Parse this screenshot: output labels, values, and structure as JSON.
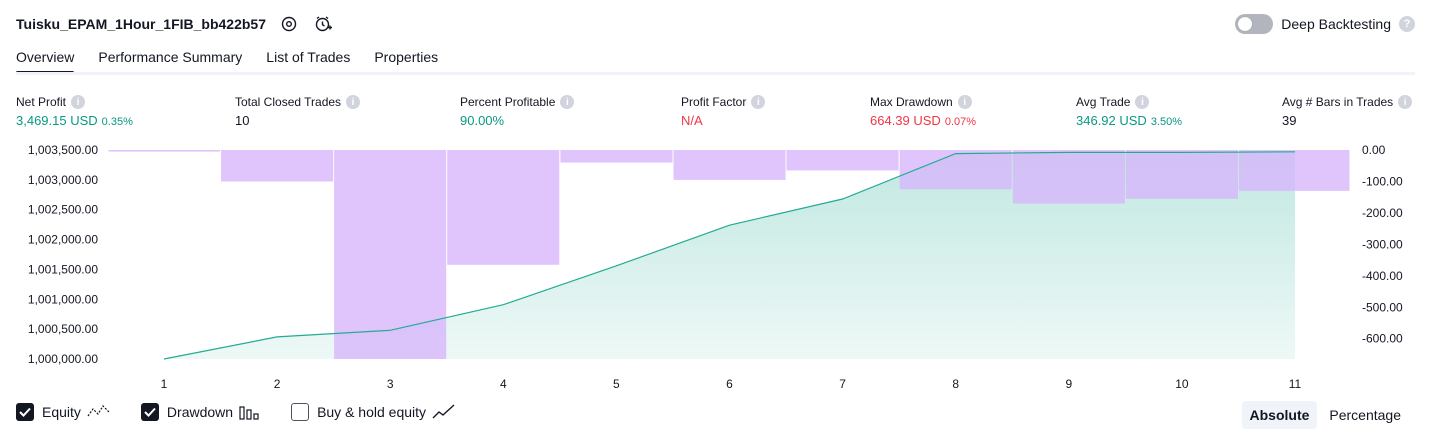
{
  "header": {
    "title": "Tuisku_EPAM_1Hour_1FIB_bb422b57",
    "icons": [
      "settings-icon",
      "add-alert-icon"
    ],
    "deep_backtesting_label": "Deep Backtesting",
    "deep_backtesting_enabled": false
  },
  "tabs": [
    {
      "label": "Overview",
      "active": true
    },
    {
      "label": "Performance Summary",
      "active": false
    },
    {
      "label": "List of Trades",
      "active": false
    },
    {
      "label": "Properties",
      "active": false
    }
  ],
  "metrics": [
    {
      "label": "Net Profit",
      "value": "3,469.15 USD",
      "percent": "0.35%",
      "color": "#089981"
    },
    {
      "label": "Total Closed Trades",
      "value": "10",
      "percent": "",
      "color": "#131722"
    },
    {
      "label": "Percent Profitable",
      "value": "90.00%",
      "percent": "",
      "color": "#089981"
    },
    {
      "label": "Profit Factor",
      "value": "N/A",
      "percent": "",
      "color": "#f23645"
    },
    {
      "label": "Max Drawdown",
      "value": "664.39 USD",
      "percent": "0.07%",
      "color": "#f23645"
    },
    {
      "label": "Avg Trade",
      "value": "346.92 USD",
      "percent": "3.50%",
      "color": "#089981"
    },
    {
      "label": "Avg # Bars in Trades",
      "value": "39",
      "percent": "",
      "color": "#131722"
    }
  ],
  "chart_data": {
    "type": "line",
    "x": [
      1,
      2,
      3,
      4,
      5,
      6,
      7,
      8,
      9,
      10,
      11
    ],
    "series": [
      {
        "name": "Equity",
        "axis": "left",
        "type": "area",
        "values": [
          1000000,
          1000370,
          1000480,
          1000910,
          1001560,
          1002240,
          1002680,
          1003440,
          1003460,
          1003460,
          1003469.15
        ]
      },
      {
        "name": "Drawdown",
        "axis": "right",
        "type": "bar",
        "values": [
          -5,
          -100,
          -664.39,
          -365,
          -40,
          -95,
          -65,
          -125,
          -170,
          -155,
          -130
        ]
      }
    ],
    "y_left": {
      "ticks": [
        "1,000,000.00",
        "1,000,500.00",
        "1,001,000.00",
        "1,001,500.00",
        "1,002,000.00",
        "1,002,500.00",
        "1,003,000.00",
        "1,003,500.00"
      ],
      "ylim": [
        1000000,
        1003500
      ]
    },
    "y_right": {
      "ticks": [
        "0.00",
        "-100.00",
        "-200.00",
        "-300.00",
        "-400.00",
        "-500.00",
        "-600.00"
      ],
      "ylim": [
        -664.39,
        0
      ]
    },
    "x_ticks": [
      "1",
      "2",
      "3",
      "4",
      "5",
      "6",
      "7",
      "8",
      "9",
      "10",
      "11"
    ],
    "colors": {
      "equity_line": "#22ab94",
      "equity_fill": "#22ab94",
      "drawdown_bar": "#d7b6fb"
    }
  },
  "legend": [
    {
      "label": "Equity",
      "checked": true,
      "icon": "equity-line-icon"
    },
    {
      "label": "Drawdown",
      "checked": true,
      "icon": "drawdown-bars-icon"
    },
    {
      "label": "Buy & hold equity",
      "checked": false,
      "icon": "buy-hold-line-icon"
    }
  ],
  "mode_buttons": [
    {
      "label": "Absolute",
      "active": true
    },
    {
      "label": "Percentage",
      "active": false
    }
  ]
}
